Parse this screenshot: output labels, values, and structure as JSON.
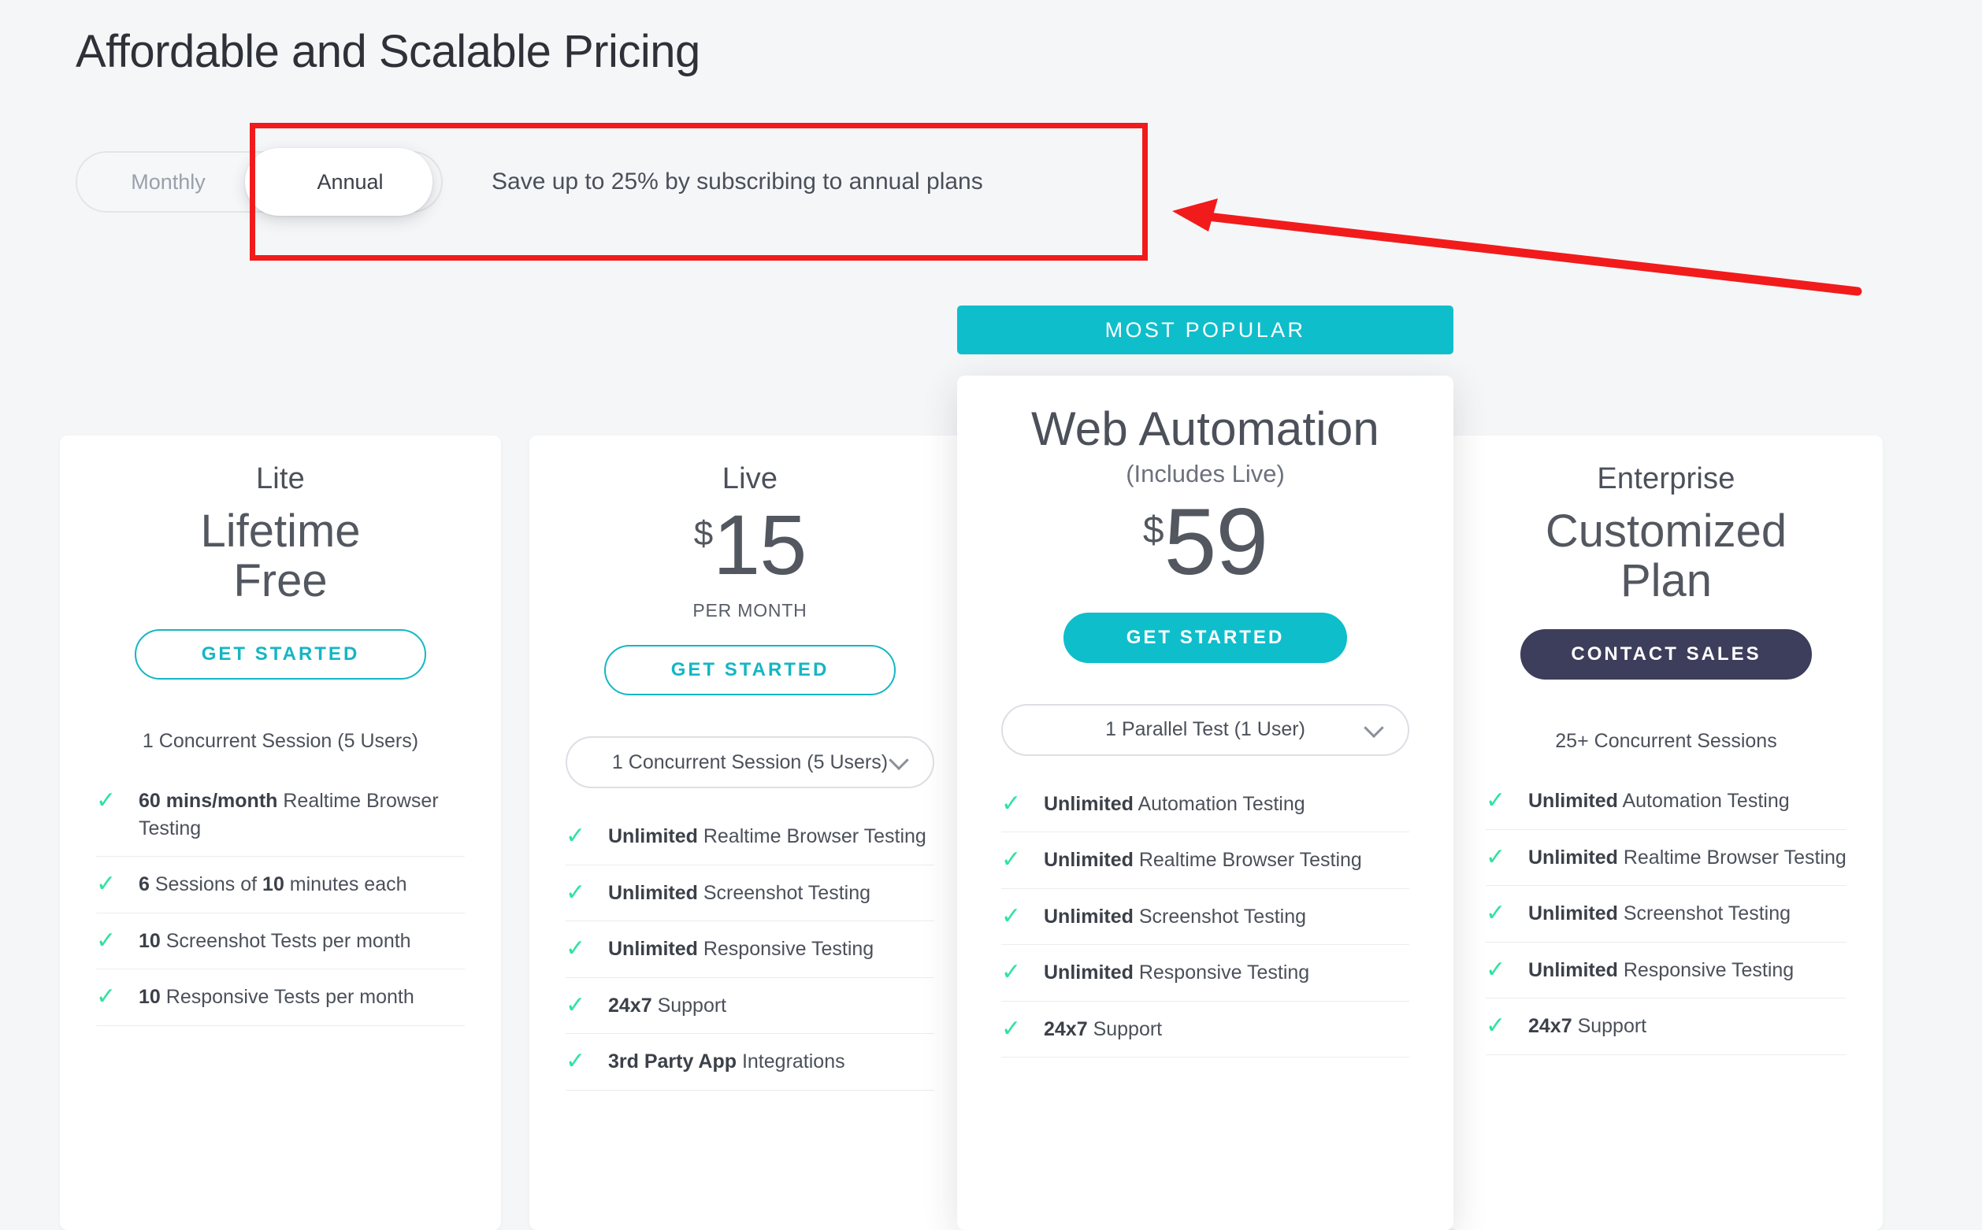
{
  "page": {
    "title": "Affordable and Scalable Pricing"
  },
  "billing": {
    "monthly_label": "Monthly",
    "annual_label": "Annual",
    "active": "Annual",
    "save_note": "Save up to 25% by subscribing to annual plans"
  },
  "popular_banner": "MOST POPULAR",
  "colors": {
    "accent_teal": "#0FBECB",
    "cta_outline_teal": "#14B6C4",
    "navy": "#3D3D5C",
    "check_green": "#2FE3A0",
    "annotation_red": "#F21B1B",
    "page_background": "#F5F6F8"
  },
  "plans": [
    {
      "name": "Lite",
      "headline": "Lifetime\nFree",
      "price_currency": "",
      "price_amount": "",
      "price_period": "",
      "cta_label": "GET STARTED",
      "cta_style": "outline-teal",
      "session_text": "1 Concurrent Session (5 Users)",
      "session_is_select": false,
      "features": [
        {
          "strong": "60 mins/month",
          "rest": " Realtime Browser Testing"
        },
        {
          "strong": "6",
          "rest": " Sessions of ",
          "strong2": "10",
          "rest2": " minutes each"
        },
        {
          "strong": "10",
          "rest": " Screenshot Tests per month"
        },
        {
          "strong": "10",
          "rest": " Responsive Tests per month"
        }
      ]
    },
    {
      "name": "Live",
      "headline": "",
      "price_currency": "$",
      "price_amount": "15",
      "price_period": "PER MONTH",
      "cta_label": "GET STARTED",
      "cta_style": "outline-teal",
      "session_text": "1 Concurrent Session (5 Users)",
      "session_is_select": true,
      "features": [
        {
          "strong": "Unlimited",
          "rest": " Realtime Browser Testing"
        },
        {
          "strong": "Unlimited",
          "rest": " Screenshot Testing"
        },
        {
          "strong": "Unlimited",
          "rest": " Responsive Testing"
        },
        {
          "strong": "24x7",
          "rest": " Support"
        },
        {
          "strong": "3rd Party App",
          "rest": " Integrations"
        }
      ]
    },
    {
      "name": "Web Automation",
      "name_sub": "(Includes Live)",
      "headline": "",
      "price_currency": "$",
      "price_amount": "59",
      "price_period": "",
      "cta_label": "GET STARTED",
      "cta_style": "solid-teal",
      "session_text": "1 Parallel Test (1 User)",
      "session_is_select": true,
      "badge": "MOST POPULAR",
      "features": [
        {
          "strong": "Unlimited",
          "rest": " Automation Testing"
        },
        {
          "strong": "Unlimited",
          "rest": " Realtime Browser Testing"
        },
        {
          "strong": "Unlimited",
          "rest": " Screenshot Testing"
        },
        {
          "strong": "Unlimited",
          "rest": " Responsive Testing"
        },
        {
          "strong": "24x7",
          "rest": " Support"
        }
      ]
    },
    {
      "name": "Enterprise",
      "headline": "Customized\nPlan",
      "price_currency": "",
      "price_amount": "",
      "price_period": "",
      "cta_label": "CONTACT SALES",
      "cta_style": "solid-navy",
      "session_text": "25+ Concurrent Sessions",
      "session_is_select": false,
      "features": [
        {
          "strong": "Unlimited",
          "rest": " Automation Testing"
        },
        {
          "strong": "Unlimited",
          "rest": " Realtime Browser Testing"
        },
        {
          "strong": "Unlimited",
          "rest": " Screenshot Testing"
        },
        {
          "strong": "Unlimited",
          "rest": " Responsive Testing"
        },
        {
          "strong": "24x7",
          "rest": " Support"
        }
      ]
    }
  ]
}
